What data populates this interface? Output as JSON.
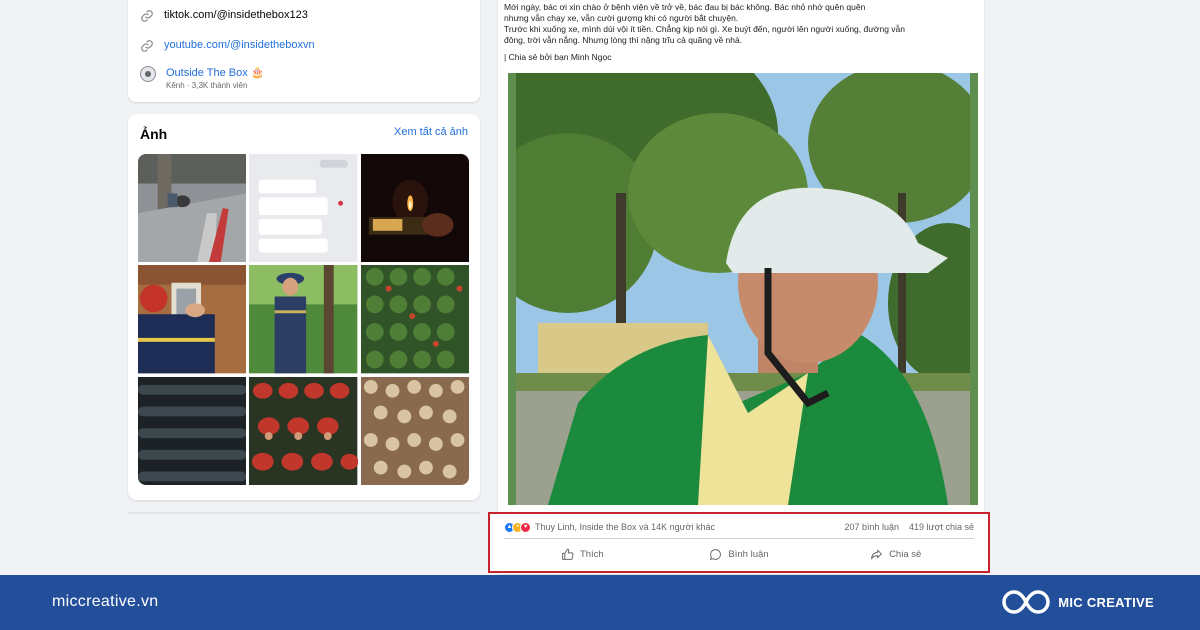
{
  "intro": {
    "tiktok_link": "tiktok.com/@insidethebox123",
    "youtube_link": "youtube.com/@insidetheboxvn",
    "group_name": "Outside The Box 🎂",
    "group_meta": "Kênh · 3,3K thành viên"
  },
  "photos": {
    "title": "Ảnh",
    "see_all": "Xem tất cả ảnh"
  },
  "post": {
    "lines": [
      "Mới ngày, bác ơi xin chào ở bệnh viện về trở về, bác đau bị bác không. Bác nhỏ nhớ quên quên",
      "nhưng vẫn chạy xe, vẫn cười gượng khi có người bắt chuyện.",
      "Trước khi xuống xe, mình dúi vội ít tiền. Chẳng kịp nói gì. Xe buýt đến, người lên người xuống, đường vẫn",
      "đông, trời vẫn nắng. Nhưng lòng thì nặng trĩu cả quãng về nhà.",
      "| Chia sẻ bởi bạn Minh Ngọc"
    ],
    "reactors": "Thuy Linh, Inside the Box và 14K người khác",
    "comments": "207 bình luận",
    "shares": "419 lượt chia sẻ",
    "like_label": "Thích",
    "comment_label": "Bình luận",
    "share_label": "Chia sẻ"
  },
  "footer": {
    "site": "miccreative.vn",
    "brand": "MIC CREATIVE"
  },
  "colors": {
    "accent_blue": "#216fdb",
    "footer_bg": "#234e9a",
    "highlight_red": "#c8222c"
  }
}
